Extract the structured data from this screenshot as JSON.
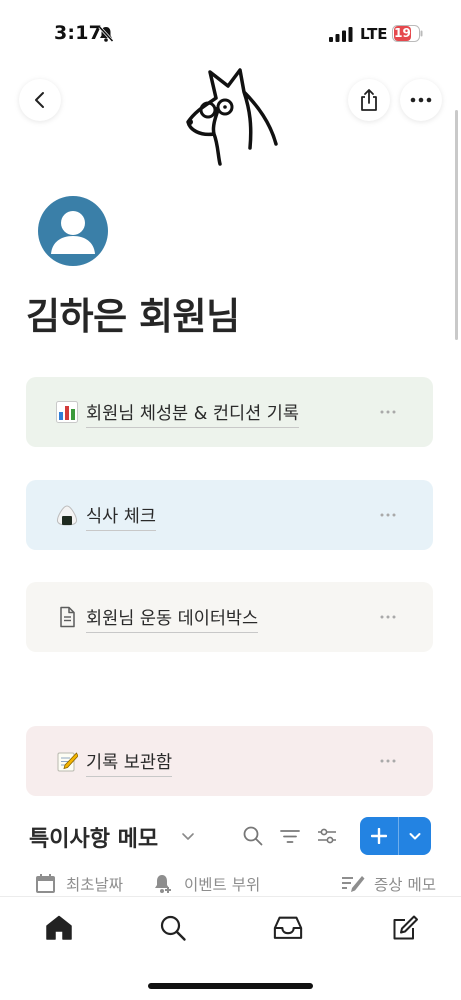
{
  "status_bar": {
    "time": "3:17",
    "network": "LTE",
    "battery": "19",
    "battery_fraction": 0.19
  },
  "page": {
    "title": "김하은 회원님"
  },
  "cards": [
    {
      "label": "회원님 체성분 & 컨디션 기록",
      "icon": "bar-chart-icon"
    },
    {
      "label": "식사 체크",
      "icon": "rice-ball-icon"
    },
    {
      "label": "회원님 운동 데이터박스",
      "icon": "document-icon"
    },
    {
      "label": "기록 보관함",
      "icon": "memo-icon"
    }
  ],
  "section": {
    "title": "특이사항 메모",
    "columns": [
      {
        "label": "최초날짜",
        "icon": "calendar-icon"
      },
      {
        "label": "이벤트 부위",
        "icon": "bell-icon"
      },
      {
        "label": "증상 메모",
        "icon": "text-edit-icon"
      }
    ]
  },
  "colors": {
    "accent": "#2383e2",
    "avatar": "#3a7fa8",
    "battery_low": "#e5484d",
    "card_green": "#edf3ec",
    "card_blue": "#e7f2f8",
    "card_gray": "#f7f6f3",
    "card_red": "#f7eded"
  },
  "tab_bar": {
    "items": [
      "home-icon",
      "search-icon",
      "inbox-icon",
      "edit-icon"
    ]
  }
}
